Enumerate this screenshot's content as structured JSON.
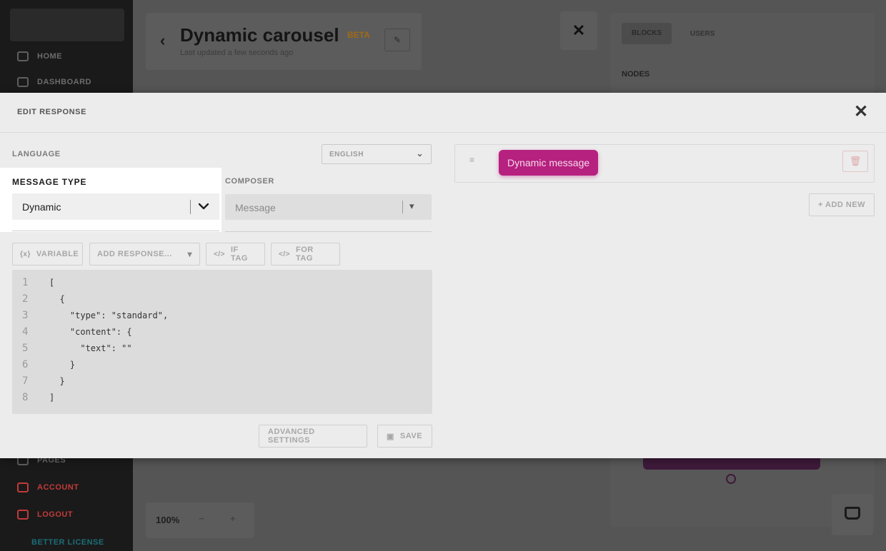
{
  "background": {
    "sidebar": {
      "items": [
        {
          "label": "HOME",
          "icon": "home-icon"
        },
        {
          "label": "DASHBOARD",
          "icon": "dashboard-icon"
        },
        {
          "label": "PAGES",
          "icon": "pages-icon"
        },
        {
          "label": "ACCOUNT",
          "icon": "user-icon"
        },
        {
          "label": "LOGOUT",
          "icon": "logout-icon"
        }
      ],
      "footer_label": "BETTER LICENSE"
    },
    "header": {
      "back_glyph": "‹",
      "title": "Dynamic carousel",
      "badge": "BETA",
      "subtitle": "Last updated a few seconds ago",
      "edit_glyph": "✎",
      "close_glyph": "✕"
    },
    "right_panel": {
      "tabs": [
        "BLOCKS",
        "USERS"
      ],
      "section_label": "NODES"
    },
    "zoom": {
      "value": "100%",
      "minus": "−",
      "plus": "+"
    }
  },
  "modal": {
    "title": "EDIT RESPONSE",
    "close_glyph": "✕",
    "language": {
      "label": "LANGUAGE",
      "value": "ENGLISH"
    },
    "message_type": {
      "label": "MESSAGE TYPE",
      "value": "Dynamic"
    },
    "composer": {
      "label": "COMPOSER",
      "value": "Message"
    },
    "toolbar": {
      "variable": "VARIABLE",
      "add_response": "ADD RESPONSE...",
      "if_tag": "IF TAG",
      "for_tag": "FOR TAG"
    },
    "editor": {
      "line_numbers": [
        "1",
        "2",
        "3",
        "4",
        "5",
        "6",
        "7",
        "8"
      ],
      "lines": [
        "[",
        "  {",
        "    \"type\": \"standard\",",
        "    \"content\": {",
        "      \"text\": \"\"",
        "    }",
        "  }",
        "]"
      ]
    },
    "footer": {
      "advanced_settings": "ADVANCED SETTINGS",
      "save": "SAVE"
    },
    "responses": {
      "chip_label": "Dynamic message",
      "add_new": "+ ADD NEW"
    },
    "colors": {
      "chip": "#b6207f",
      "modal_bg": "#ececec"
    }
  }
}
